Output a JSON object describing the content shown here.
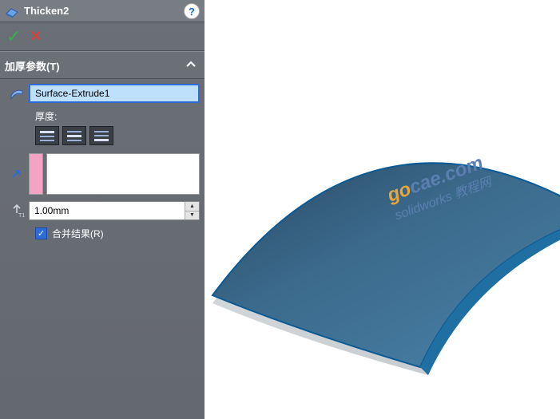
{
  "header": {
    "feature_name": "Thicken2",
    "help_label": "?"
  },
  "confirm": {
    "ok": "✓",
    "cancel": "✕"
  },
  "section": {
    "title": "加厚参数(T)"
  },
  "selection": {
    "value": "Surface-Extrude1"
  },
  "thickness": {
    "label": "厚度:"
  },
  "depth": {
    "value": "1.00mm"
  },
  "merge": {
    "checked": true,
    "label": "合并结果(R)"
  },
  "watermark": {
    "line1a": "go",
    "line1b": "cae.com",
    "line2": "solidworks 教程网"
  }
}
